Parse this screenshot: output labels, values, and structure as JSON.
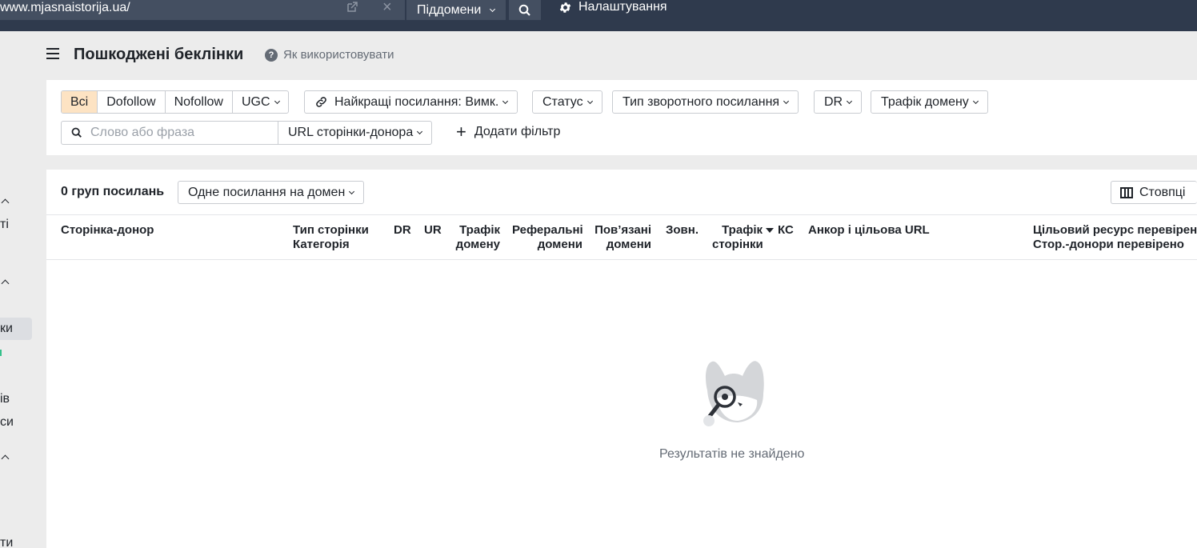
{
  "topbar": {
    "url": "www.mjasnaistorija.ua/",
    "subdomains_label": "Піддомени",
    "settings_label": "Налаштування"
  },
  "sidebar": {
    "fragments": [
      "ті",
      "ки",
      "ів",
      "си",
      "ти"
    ]
  },
  "header": {
    "title": "Пошкоджені беклінки",
    "howto_label": "Як використовувати"
  },
  "filters": {
    "link_types": [
      "Всі",
      "Dofollow",
      "Nofollow",
      "UGC"
    ],
    "active_link_type": "Всі",
    "best_links": "Найкращі посилання: Вимк.",
    "status": "Статус",
    "backlink_type": "Тип зворотного посилання",
    "dr": "DR",
    "domain_traffic": "Трафік домену",
    "search_placeholder": "Слово або фраза",
    "search_value": "",
    "scope": "URL сторінки-донора",
    "add_filter": "Додати фільтр"
  },
  "results": {
    "count_label": "0 груп посилань",
    "grouping": "Одне посилання на домен",
    "columns_button": "Стовпці",
    "columns": {
      "referring_page": "Сторінка-донор",
      "page_type": "Тип сторінки",
      "category": "Категорія",
      "dr": "DR",
      "ur": "UR",
      "domain_traffic_1": "Трафік",
      "domain_traffic_2": "домену",
      "ref_domains_1": "Реферальні",
      "ref_domains_2": "домени",
      "linked_domains_1": "Пов’язані",
      "linked_domains_2": "домени",
      "external": "Зовн.",
      "page_traffic_1": "Трафік",
      "page_traffic_2": "сторінки",
      "kw": "КС",
      "anchor": "Анкор і цільова URL",
      "target_checked": "Цільовий ресурс перевірено",
      "donor_checked": "Стор.-донори перевірено"
    },
    "empty_message": "Результатів не знайдено"
  },
  "colors": {
    "topbar": "#2f3a4d",
    "active_segment": "#fde3c3"
  }
}
